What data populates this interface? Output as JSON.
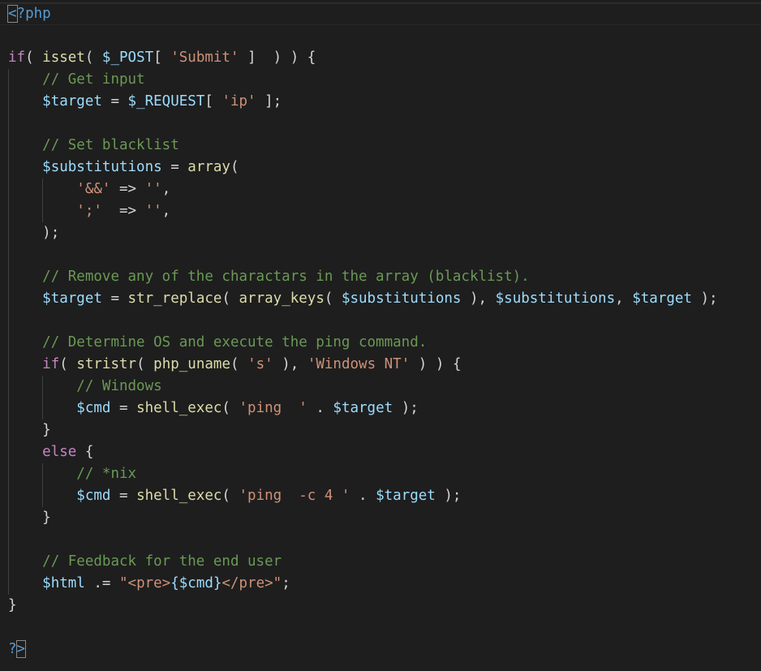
{
  "editor": {
    "language": "php",
    "theme_colors": {
      "background": "#1e1e1e",
      "keyword": "#c586c0",
      "function": "#dcdcaa",
      "variable": "#9cdcfe",
      "string": "#ce9178",
      "comment": "#6a9955",
      "tag": "#569cd6",
      "text": "#d4d4d4"
    },
    "lines": [
      {
        "indent": 0,
        "tokens": [
          [
            "tag bm",
            "<"
          ],
          [
            "tag",
            "?php"
          ]
        ]
      },
      {
        "indent": 0,
        "tokens": []
      },
      {
        "indent": 0,
        "tokens": [
          [
            "kw",
            "if"
          ],
          [
            "op",
            "( "
          ],
          [
            "fn",
            "isset"
          ],
          [
            "op",
            "( "
          ],
          [
            "var",
            "$_POST"
          ],
          [
            "op",
            "[ "
          ],
          [
            "str",
            "'Submit'"
          ],
          [
            "op",
            " ]  ) ) {"
          ]
        ]
      },
      {
        "indent": 1,
        "tokens": [
          [
            "com",
            "// Get input"
          ]
        ]
      },
      {
        "indent": 1,
        "tokens": [
          [
            "var",
            "$target"
          ],
          [
            "op",
            " = "
          ],
          [
            "var",
            "$_REQUEST"
          ],
          [
            "op",
            "[ "
          ],
          [
            "str",
            "'ip'"
          ],
          [
            "op",
            " ];"
          ]
        ]
      },
      {
        "indent": 1,
        "tokens": []
      },
      {
        "indent": 1,
        "tokens": [
          [
            "com",
            "// Set blacklist"
          ]
        ]
      },
      {
        "indent": 1,
        "tokens": [
          [
            "var",
            "$substitutions"
          ],
          [
            "op",
            " = "
          ],
          [
            "fn",
            "array"
          ],
          [
            "op",
            "("
          ]
        ]
      },
      {
        "indent": 2,
        "tokens": [
          [
            "str",
            "'&&'"
          ],
          [
            "op",
            " => "
          ],
          [
            "str",
            "''"
          ],
          [
            "op",
            ","
          ]
        ]
      },
      {
        "indent": 2,
        "tokens": [
          [
            "str",
            "';'"
          ],
          [
            "op",
            "  => "
          ],
          [
            "str",
            "''"
          ],
          [
            "op",
            ","
          ]
        ]
      },
      {
        "indent": 1,
        "tokens": [
          [
            "op",
            ");"
          ]
        ]
      },
      {
        "indent": 1,
        "tokens": []
      },
      {
        "indent": 1,
        "tokens": [
          [
            "com",
            "// Remove any of the charactars in the array (blacklist)."
          ]
        ]
      },
      {
        "indent": 1,
        "tokens": [
          [
            "var",
            "$target"
          ],
          [
            "op",
            " = "
          ],
          [
            "fn",
            "str_replace"
          ],
          [
            "op",
            "( "
          ],
          [
            "fn",
            "array_keys"
          ],
          [
            "op",
            "( "
          ],
          [
            "var",
            "$substitutions"
          ],
          [
            "op",
            " ), "
          ],
          [
            "var",
            "$substitutions"
          ],
          [
            "op",
            ", "
          ],
          [
            "var",
            "$target"
          ],
          [
            "op",
            " );"
          ]
        ]
      },
      {
        "indent": 1,
        "tokens": []
      },
      {
        "indent": 1,
        "tokens": [
          [
            "com",
            "// Determine OS and execute the ping command."
          ]
        ]
      },
      {
        "indent": 1,
        "tokens": [
          [
            "kw",
            "if"
          ],
          [
            "op",
            "( "
          ],
          [
            "fn",
            "stristr"
          ],
          [
            "op",
            "( "
          ],
          [
            "fn",
            "php_uname"
          ],
          [
            "op",
            "( "
          ],
          [
            "str",
            "'s'"
          ],
          [
            "op",
            " ), "
          ],
          [
            "str",
            "'Windows NT'"
          ],
          [
            "op",
            " ) ) {"
          ]
        ]
      },
      {
        "indent": 2,
        "tokens": [
          [
            "com",
            "// Windows"
          ]
        ]
      },
      {
        "indent": 2,
        "tokens": [
          [
            "var",
            "$cmd"
          ],
          [
            "op",
            " = "
          ],
          [
            "fn",
            "shell_exec"
          ],
          [
            "op",
            "( "
          ],
          [
            "str",
            "'ping  '"
          ],
          [
            "op",
            " . "
          ],
          [
            "var",
            "$target"
          ],
          [
            "op",
            " );"
          ]
        ]
      },
      {
        "indent": 1,
        "tokens": [
          [
            "op",
            "}"
          ]
        ]
      },
      {
        "indent": 1,
        "tokens": [
          [
            "kw",
            "else"
          ],
          [
            "op",
            " {"
          ]
        ]
      },
      {
        "indent": 2,
        "tokens": [
          [
            "com",
            "// *nix"
          ]
        ]
      },
      {
        "indent": 2,
        "tokens": [
          [
            "var",
            "$cmd"
          ],
          [
            "op",
            " = "
          ],
          [
            "fn",
            "shell_exec"
          ],
          [
            "op",
            "( "
          ],
          [
            "str",
            "'ping  -c 4 '"
          ],
          [
            "op",
            " . "
          ],
          [
            "var",
            "$target"
          ],
          [
            "op",
            " );"
          ]
        ]
      },
      {
        "indent": 1,
        "tokens": [
          [
            "op",
            "}"
          ]
        ]
      },
      {
        "indent": 1,
        "tokens": []
      },
      {
        "indent": 1,
        "tokens": [
          [
            "com",
            "// Feedback for the end user"
          ]
        ]
      },
      {
        "indent": 1,
        "tokens": [
          [
            "var",
            "$html"
          ],
          [
            "op",
            " .= "
          ],
          [
            "str",
            "\"<pre>"
          ],
          [
            "var",
            "{$cmd}"
          ],
          [
            "str",
            "</pre>\""
          ],
          [
            "op",
            ";"
          ]
        ]
      },
      {
        "indent": 0,
        "tokens": [
          [
            "op",
            "}"
          ]
        ]
      },
      {
        "indent": 0,
        "tokens": []
      },
      {
        "indent": 0,
        "tokens": [
          [
            "tag",
            "?"
          ],
          [
            "tag bm",
            ">"
          ]
        ]
      }
    ]
  }
}
